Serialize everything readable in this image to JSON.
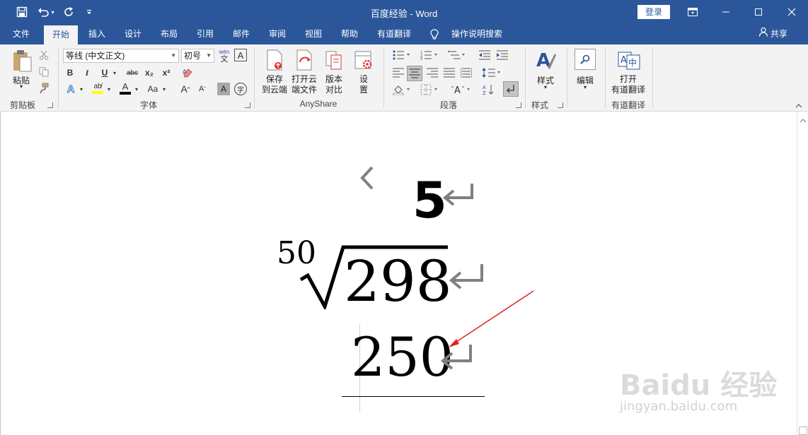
{
  "window": {
    "title": "百度经验  -  Word",
    "login": "登录",
    "share": "共享"
  },
  "tabs": [
    {
      "label": "文件"
    },
    {
      "label": "开始"
    },
    {
      "label": "插入"
    },
    {
      "label": "设计"
    },
    {
      "label": "布局"
    },
    {
      "label": "引用"
    },
    {
      "label": "邮件"
    },
    {
      "label": "审阅"
    },
    {
      "label": "视图"
    },
    {
      "label": "帮助"
    },
    {
      "label": "有道翻译"
    },
    {
      "label": "操作说明搜索"
    }
  ],
  "ribbon": {
    "clipboard": {
      "paste": "粘贴",
      "group": "剪贴板"
    },
    "font": {
      "name": "等线 (中文正文)",
      "size": "初号",
      "group": "字体",
      "bold": "B",
      "italic": "I",
      "underline": "U",
      "strike": "abc",
      "subscript": "x₂",
      "superscript": "x²",
      "case": "Aa",
      "grow": "A",
      "shrink": "A",
      "phonetic_top": "wén",
      "phonetic_bottom": "文"
    },
    "anyshare": {
      "save_cloud": [
        "保存",
        "到云端"
      ],
      "open_cloud": [
        "打开云",
        "端文件"
      ],
      "compare": [
        "版本",
        "对比"
      ],
      "settings": "设",
      "settings2": "置",
      "group": "AnyShare"
    },
    "paragraph": {
      "group": "段落"
    },
    "styles": {
      "label": "样式",
      "group": "样式"
    },
    "editing": {
      "label": "编辑"
    },
    "youdao": {
      "line1": "打开",
      "line2": "有道翻译",
      "group": "有道翻译"
    }
  },
  "document": {
    "line1": "5",
    "root_index": "50",
    "radicand": "298",
    "line3": "250",
    "para_mark": "↵"
  },
  "watermark": {
    "main": "Baidu 经验",
    "sub": "jingyan.baidu.com"
  },
  "colors": {
    "title_bar": "#2b579a",
    "ribbon_bg": "#f3f3f3",
    "arrow": "#e02020"
  }
}
